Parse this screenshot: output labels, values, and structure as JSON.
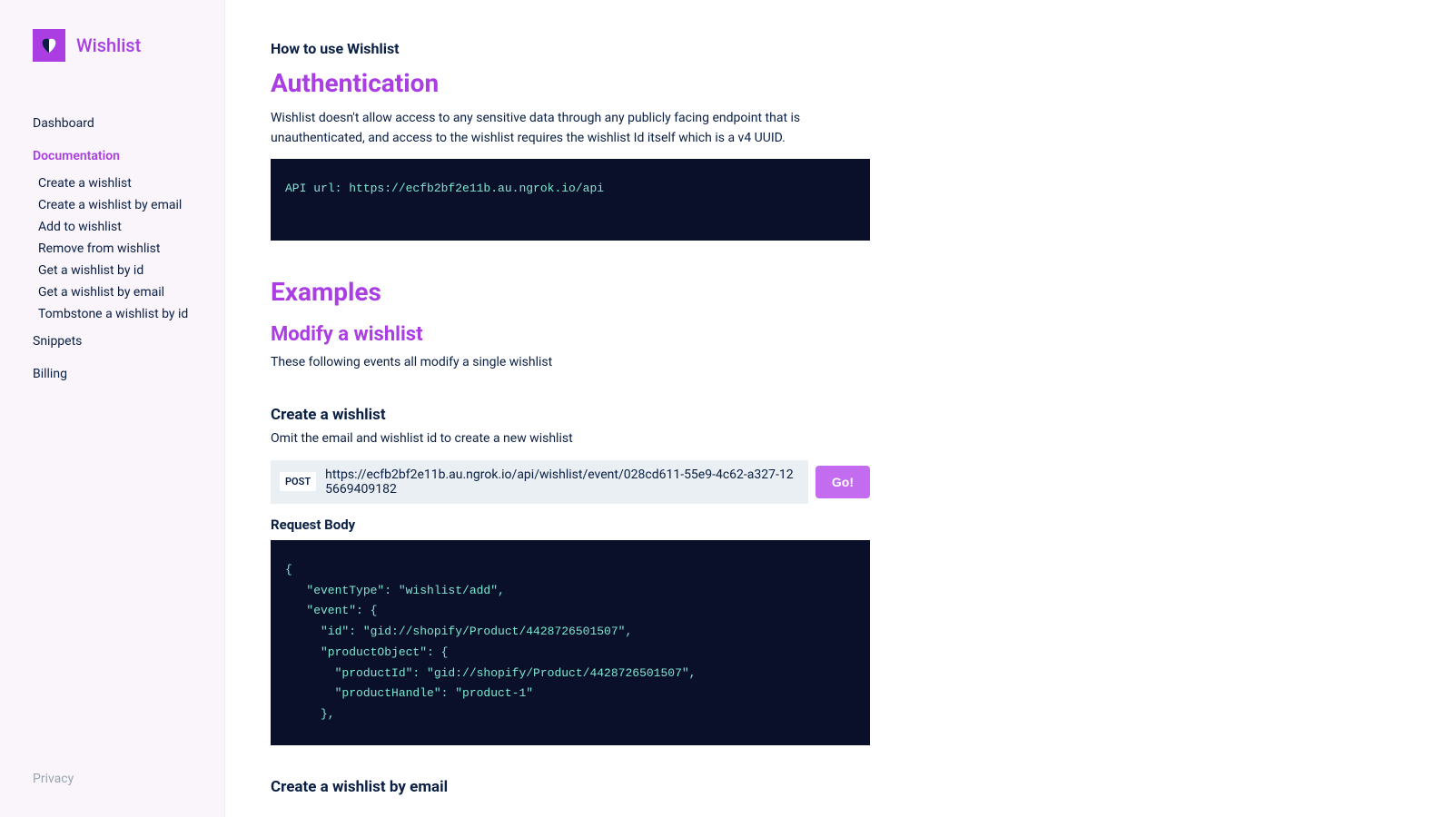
{
  "brand": "Wishlist",
  "nav": {
    "dashboard": "Dashboard",
    "documentation": "Documentation",
    "subitems": [
      "Create a wishlist",
      "Create a wishlist by email",
      "Add to wishlist",
      "Remove from wishlist",
      "Get a wishlist by id",
      "Get a wishlist by email",
      "Tombstone a wishlist by id"
    ],
    "snippets": "Snippets",
    "billing": "Billing",
    "privacy": "Privacy"
  },
  "page": {
    "howto": "How to use Wishlist",
    "auth_title": "Authentication",
    "auth_body": "Wishlist doesn't allow access to any sensitive data through any publicly facing endpoint that is unauthenticated, and access to the wishlist requires the wishlist Id itself which is a v4 UUID.",
    "api_code": "API url: https://ecfb2bf2e11b.au.ngrok.io/api",
    "examples_title": "Examples",
    "modify_title": "Modify a wishlist",
    "modify_body": "These following events all modify a single wishlist",
    "create_title": "Create a wishlist",
    "create_desc": "Omit the email and wishlist id to create a new wishlist",
    "method": "POST",
    "endpoint_url": "https://ecfb2bf2e11b.au.ngrok.io/api/wishlist/event/028cd611-55e9-4c62-a327-125669409182",
    "go_label": "Go!",
    "req_body_label": "Request Body",
    "req_body_code": "{\n   \"eventType\": \"wishlist/add\",\n   \"event\": {\n     \"id\": \"gid://shopify/Product/4428726501507\",\n     \"productObject\": {\n       \"productId\": \"gid://shopify/Product/4428726501507\",\n       \"productHandle\": \"product-1\"\n     },",
    "create_email_title": "Create a wishlist by email"
  }
}
